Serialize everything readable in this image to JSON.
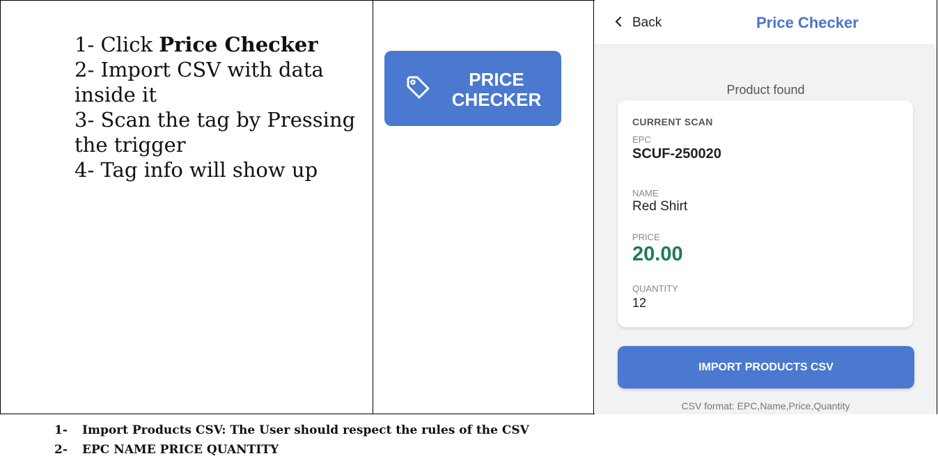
{
  "instructions": {
    "step1_prefix": "1- Click ",
    "step1_bold": "Price Checker",
    "step2_a": "2- Import CSV with data",
    "step2_b": "inside it",
    "step3_a": "3- Scan the tag by Pressing",
    "step3_b": "the trigger",
    "step4": "4- Tag info will show up"
  },
  "price_checker_button": {
    "line1": "PRICE",
    "line2": "CHECKER",
    "icon": "tag-icon"
  },
  "phone": {
    "back_label": "Back",
    "back_icon": "chevron-left-icon",
    "title": "Price Checker",
    "status": "Product found",
    "card": {
      "section": "CURRENT SCAN",
      "epc_label": "EPC",
      "epc_value": "SCUF-250020",
      "name_label": "NAME",
      "name_value": "Red Shirt",
      "price_label": "PRICE",
      "price_value": "20.00",
      "quantity_label": "QUANTITY",
      "quantity_value": "12"
    },
    "import_button": "IMPORT PRODUCTS CSV",
    "csv_format": "CSV format: EPC,Name,Price,Quantity"
  },
  "notes": [
    {
      "num": "1-",
      "text": "Import Products CSV: The User should respect the rules of the CSV"
    },
    {
      "num": "2-",
      "text": "EPC NAME PRICE QUANTITY"
    }
  ],
  "colors": {
    "accent": "#4a79cf",
    "title": "#4a76c8",
    "price": "#1f7a55"
  }
}
